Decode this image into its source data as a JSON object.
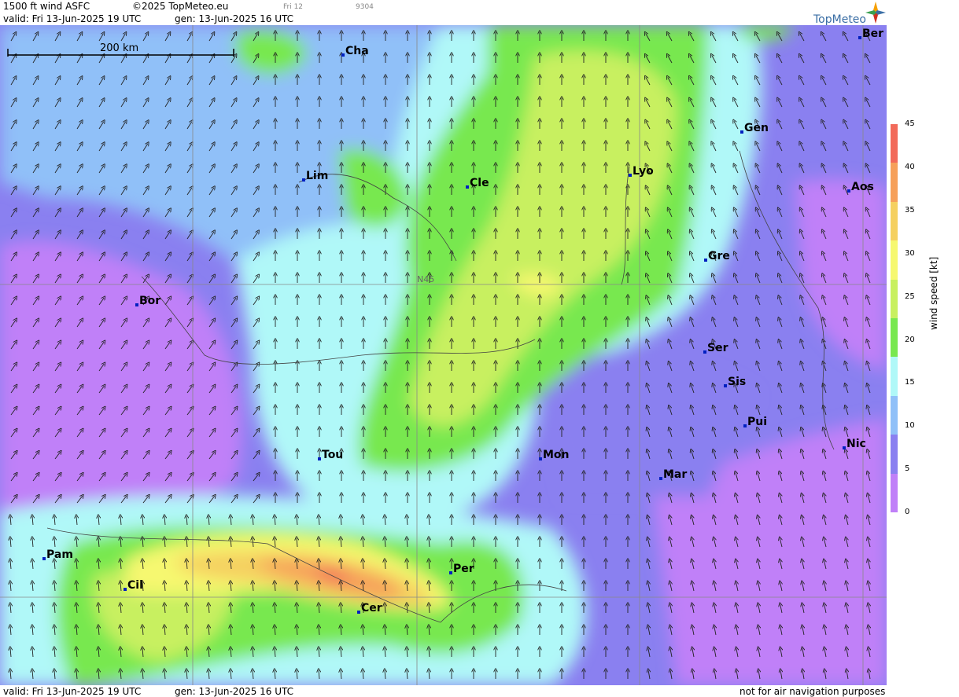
{
  "header": {
    "product": "1500 ft wind ASFC",
    "copyright": "©2025 TopMeteo.eu",
    "day_tag": "Fri 12",
    "code": "9304",
    "valid": "valid:  Fri  13-Jun-2025  19 UTC",
    "gen": "gen: 13-Jun-2025 16 UTC"
  },
  "logo": {
    "text": "TopMeteo",
    "icon": "compass-star-icon"
  },
  "map": {
    "scale_label": "200 km",
    "lat_label": "N45",
    "cities": [
      {
        "code": "Cha"
      },
      {
        "code": "Ber"
      },
      {
        "code": "Gen"
      },
      {
        "code": "Lim"
      },
      {
        "code": "Cle"
      },
      {
        "code": "Lyo"
      },
      {
        "code": "Aos"
      },
      {
        "code": "Gre"
      },
      {
        "code": "Bor"
      },
      {
        "code": "Ser"
      },
      {
        "code": "Sis"
      },
      {
        "code": "Pui"
      },
      {
        "code": "Nic"
      },
      {
        "code": "Tou"
      },
      {
        "code": "Mon"
      },
      {
        "code": "Mar"
      },
      {
        "code": "Pam"
      },
      {
        "code": "Per"
      },
      {
        "code": "Cil"
      },
      {
        "code": "Cer"
      }
    ]
  },
  "legend": {
    "title": "wind  speed  [kt]",
    "ticks": [
      "45",
      "40",
      "35",
      "30",
      "25",
      "20",
      "15",
      "10",
      "5",
      "0"
    ],
    "colors": [
      "#f26a5a",
      "#f6a05a",
      "#f5d060",
      "#f6f870",
      "#c8f060",
      "#78e850",
      "#b0f8f8",
      "#90c0f8",
      "#8a80f0",
      "#c080f8"
    ]
  },
  "footer": {
    "valid": "valid:  Fri  13-Jun-2025  19 UTC",
    "gen": "gen: 13-Jun-2025 16 UTC",
    "disclaimer": "not for air navigation purposes"
  }
}
